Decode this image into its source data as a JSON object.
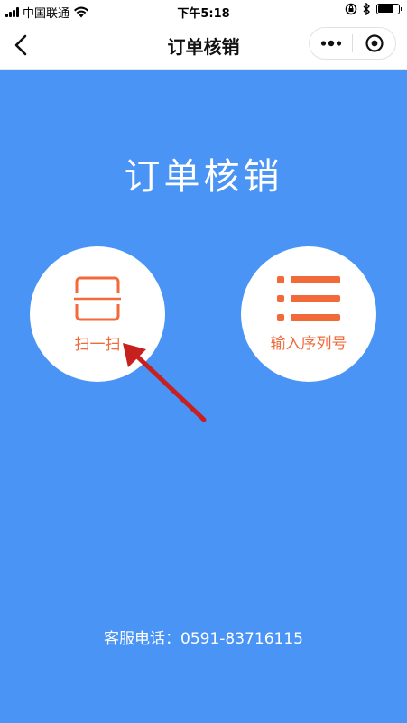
{
  "status_bar": {
    "carrier": "中国联通",
    "time": "下午5:18",
    "signal_bars": 4,
    "battery_level": 0.8
  },
  "nav": {
    "title": "订单核销",
    "back_icon": "chevron-left-icon",
    "more_icon": "more-dots-icon",
    "close_icon": "target-close-icon"
  },
  "main": {
    "title": "订单核销",
    "scan": {
      "label": "扫一扫",
      "icon": "scan-frame-icon"
    },
    "serial": {
      "label": "输入序列号",
      "icon": "list-icon"
    }
  },
  "footer": {
    "hotline": "客服电话：0591-83716115"
  },
  "colors": {
    "background": "#4a94f6",
    "accent": "#f26a3a",
    "annotation_arrow": "#c8201f"
  }
}
